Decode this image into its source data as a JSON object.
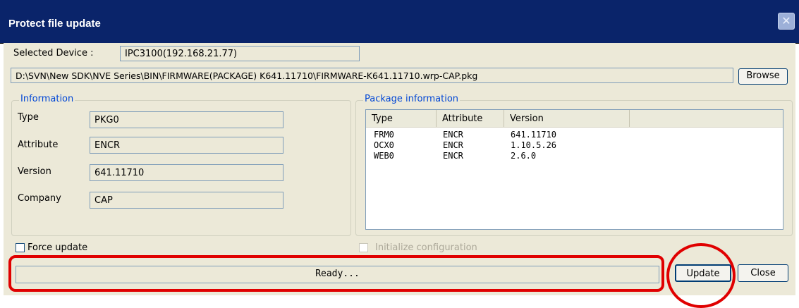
{
  "window": {
    "title": "Protect file update"
  },
  "selected_device": {
    "label": "Selected Device :",
    "value": "IPC3100(192.168.21.77)"
  },
  "path": {
    "value": "D:\\SVN\\New SDK\\NVE Series\\BIN\\FIRMWARE(PACKAGE) K641.11710\\FIRMWARE-K641.11710.wrp-CAP.pkg",
    "browse_label": "Browse"
  },
  "information": {
    "legend": "Information",
    "type_label": "Type",
    "type_value": "PKG0",
    "attribute_label": "Attribute",
    "attribute_value": "ENCR",
    "version_label": "Version",
    "version_value": "641.11710",
    "company_label": "Company",
    "company_value": "CAP"
  },
  "package_info": {
    "legend": "Package information",
    "columns": [
      "Type",
      "Attribute",
      "Version"
    ],
    "rows": [
      [
        "FRM0",
        "ENCR",
        "641.11710"
      ],
      [
        "OCX0",
        "ENCR",
        "1.10.5.26"
      ],
      [
        "WEB0",
        "ENCR",
        "2.6.0"
      ]
    ]
  },
  "options": {
    "force_update": "Force update",
    "initialize_configuration": "Initialize configuration"
  },
  "status": {
    "text": "Ready..."
  },
  "buttons": {
    "update": "Update",
    "close": "Close"
  },
  "colors": {
    "titlebar": "#0a246a",
    "annotation": "#e00000",
    "legend_text": "#0046d5"
  }
}
